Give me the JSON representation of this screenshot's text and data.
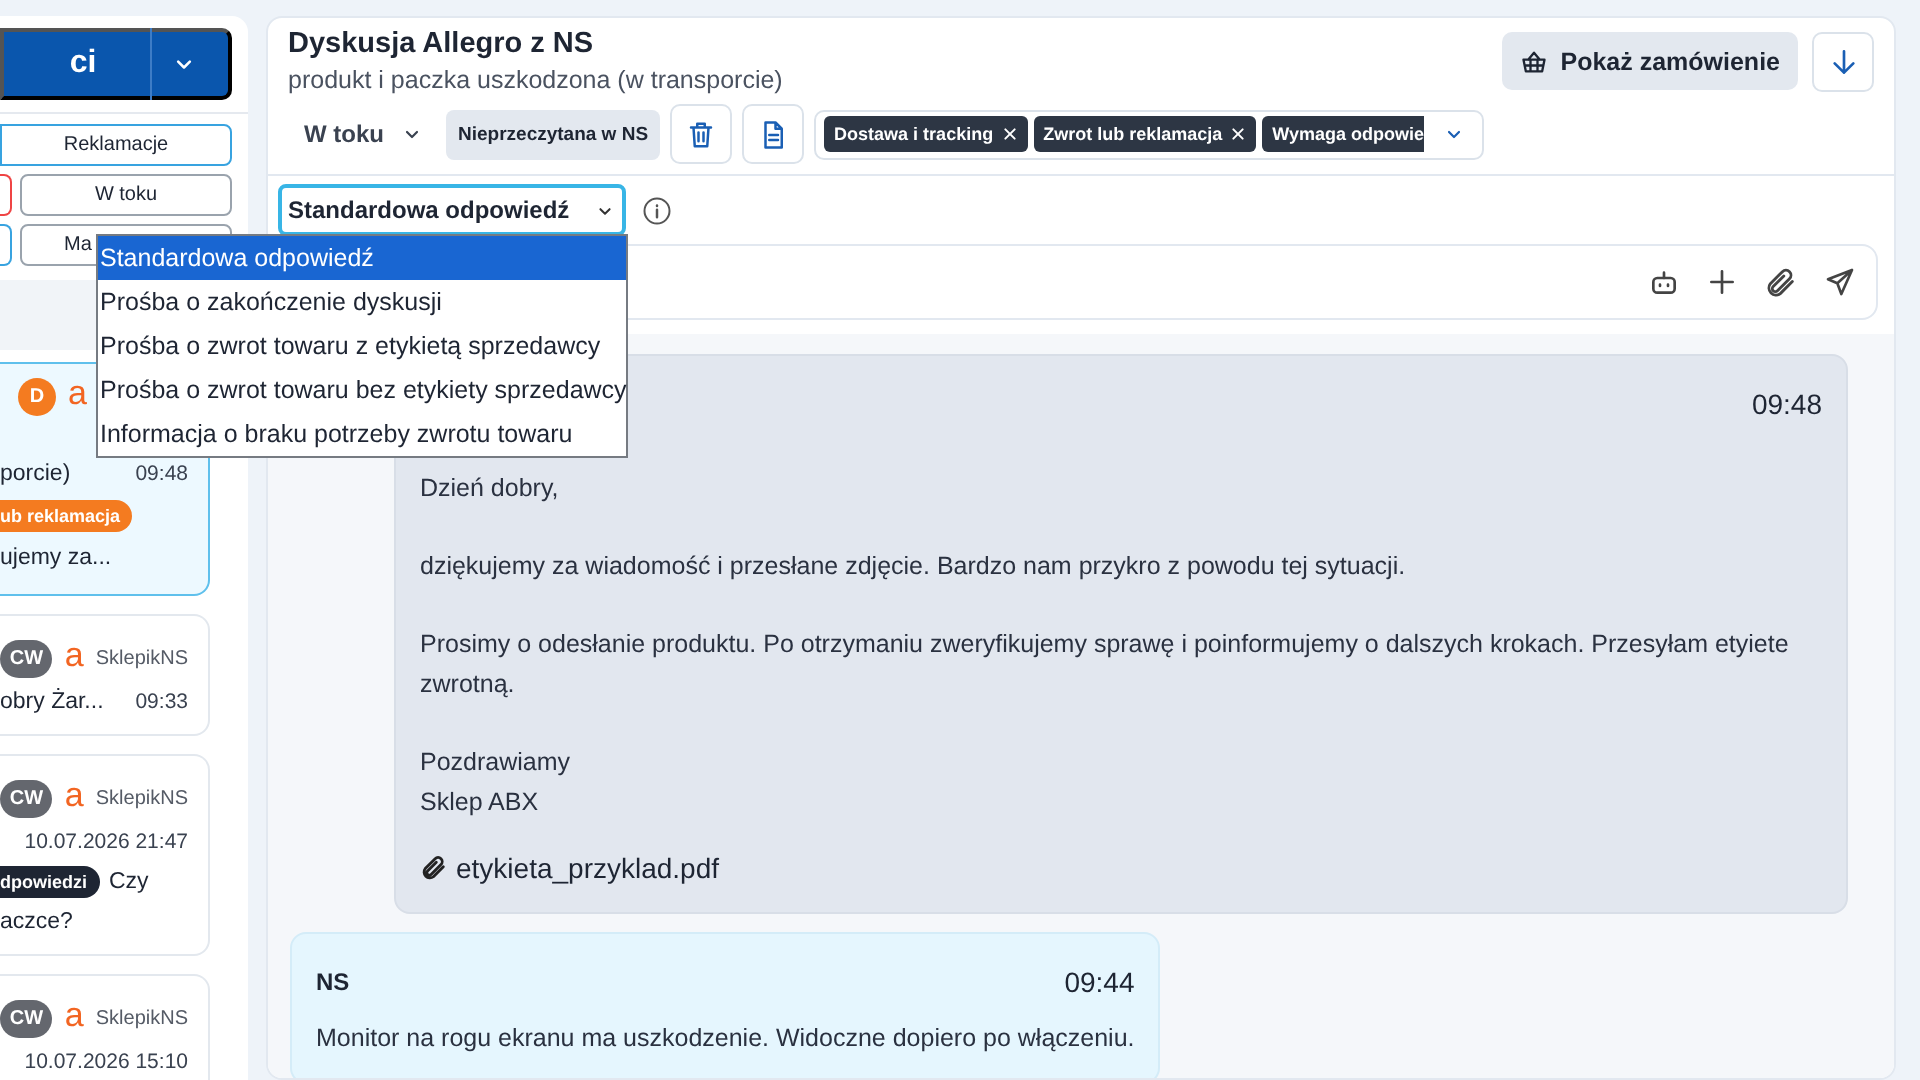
{
  "sidebar": {
    "main_button": "ci",
    "filters": [
      {
        "label": "Reklamacje",
        "selected": true
      },
      {
        "kind": "cut",
        "color": "#ef4444"
      },
      {
        "label": "W toku",
        "selected": false
      },
      {
        "kind": "cut",
        "color": "#38a3e0"
      },
      {
        "label": "Ma",
        "selected": false
      }
    ],
    "conversations": [
      {
        "selected": true,
        "badge": {
          "text": "D",
          "color": "#f47b20"
        },
        "source": "a",
        "line": "porcie)",
        "time": "09:48",
        "tag": {
          "label": "ub reklamacja",
          "color": "#f47b20"
        },
        "preview": [
          "ujemy za..."
        ]
      },
      {
        "selected": false,
        "badge": {
          "text": "CW",
          "color": "#64676e"
        },
        "source": "a",
        "shop": "SklepikNS",
        "line": "obry Żar...",
        "time": "09:33"
      },
      {
        "selected": false,
        "badge": {
          "text": "CW",
          "color": "#64676e"
        },
        "source": "a",
        "shop": "SklepikNS",
        "time": "10.07.2026 21:47",
        "tag": {
          "label": "dpowiedzi",
          "color": "#1e2533"
        },
        "tag_text": "Czy",
        "preview": [
          "aczce?"
        ]
      },
      {
        "selected": false,
        "badge": {
          "text": "CW",
          "color": "#64676e"
        },
        "source": "a",
        "shop": "SklepikNS",
        "time": "10.07.2026 15:10"
      }
    ]
  },
  "header": {
    "title": "Dyskusja Allegro z NS",
    "subtitle": "produkt i paczka uszkodzona (w transporcie)",
    "order_button": "Pokaż zamówienie"
  },
  "toolbar": {
    "status": "W toku",
    "read_state": "Nieprzeczytana w NS",
    "tags": [
      {
        "label": "Dostawa i tracking",
        "removable": true
      },
      {
        "label": "Zwrot lub reklamacja",
        "removable": true
      },
      {
        "label": "Wymaga odpowie",
        "removable": false
      }
    ]
  },
  "template_select": {
    "value": "Standardowa odpowiedź",
    "expanded": true,
    "options": [
      {
        "label": "Standardowa odpowiedź",
        "selected": true
      },
      {
        "label": "Prośba o zakończenie dyskusji",
        "selected": false
      },
      {
        "label": "Prośba o zwrot towaru z etykietą sprzedawcy",
        "selected": false
      },
      {
        "label": "Prośba o zwrot towaru bez etykiety sprzedawcy",
        "selected": false
      },
      {
        "label": "Informacja o braku potrzeby zwrotu towaru",
        "selected": false
      }
    ]
  },
  "messages": [
    {
      "kind": "outgoing",
      "time": "09:48",
      "paragraphs": [
        "Dzień dobry,",
        "dziękujemy za wiadomość i przesłane zdjęcie. Bardzo nam przykro z powodu tej sytuacji.",
        "Prosimy o odesłanie produktu. Po otrzymaniu zweryfikujemy sprawę i poinformujemy o dalszych krokach. Przesyłam etyiete zwrotną.",
        "Pozdrawiamy\nSklep ABX"
      ],
      "attachment": "etykieta_przyklad.pdf"
    },
    {
      "kind": "incoming",
      "sender": "NS",
      "time": "09:44",
      "paragraphs": [
        "Monitor na rogu ekranu ma uszkodzenie. Widoczne dopiero po włączeniu."
      ]
    }
  ]
}
